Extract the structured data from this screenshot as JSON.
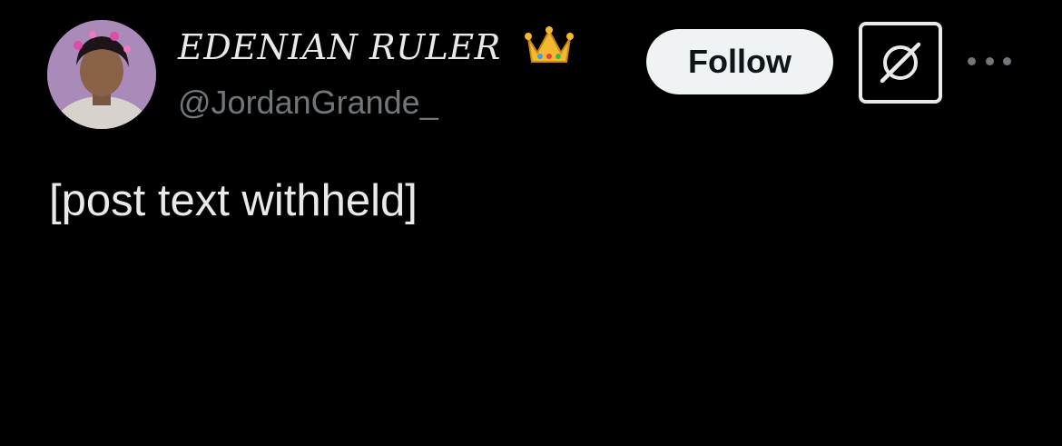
{
  "tweet": {
    "author": {
      "display_name": "EDENIAN RULER",
      "display_name_emoji": "crown",
      "handle": "@JordanGrande_",
      "avatar": "profile-photo"
    },
    "follow_label": "Follow",
    "grok_icon": "grok-icon",
    "more_icon": "more-options-icon",
    "body": "[post text withheld]"
  },
  "colors": {
    "background": "#000000",
    "text_primary": "#e7e9ea",
    "text_secondary": "#71767b",
    "button_bg": "#eff3f4",
    "button_text": "#0f1419"
  }
}
